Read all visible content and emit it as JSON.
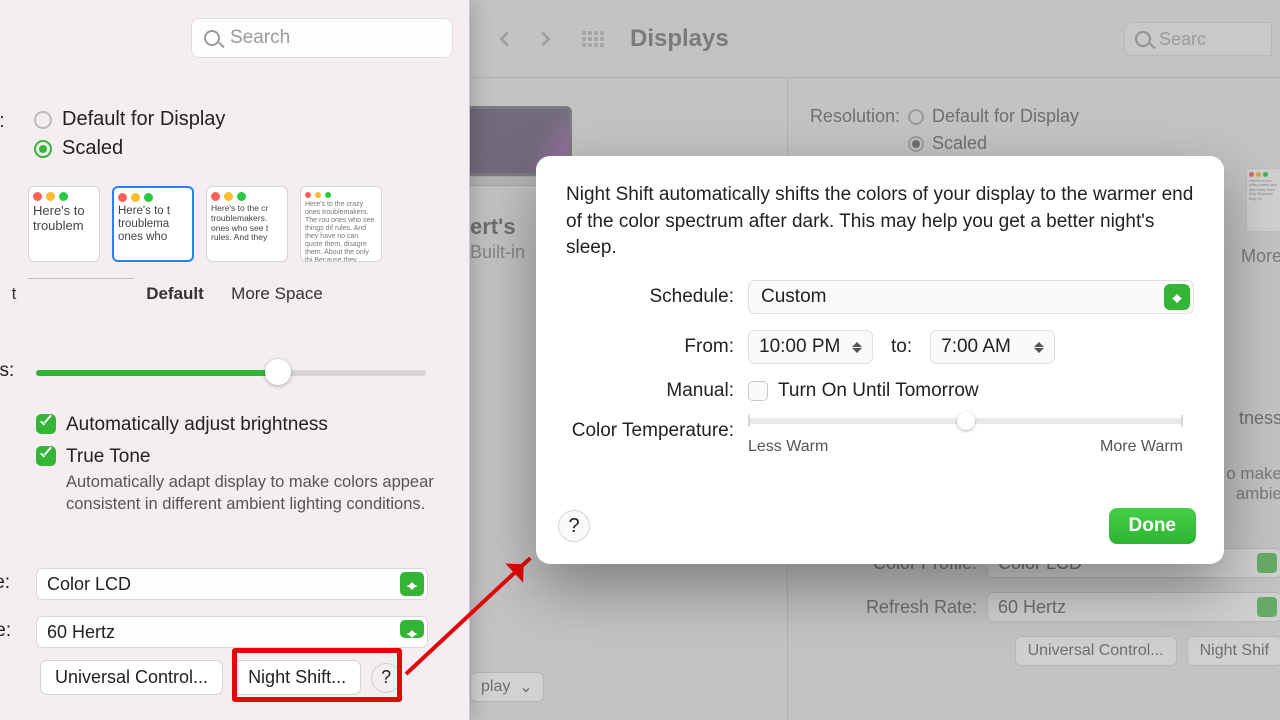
{
  "bg": {
    "title": "Displays",
    "search_placeholder": "Searc",
    "resolution_label": "Resolution:",
    "opt_default": "Default for Display",
    "opt_scaled": "Scaled",
    "more_space": "More",
    "left": {
      "name": "ert's",
      "sub": "Built-in"
    },
    "brightness_label": "tness",
    "truetone_tail1": "o make",
    "truetone_tail2": "ambie",
    "color_profile_label": "Color Profile:",
    "color_profile_value": "Color LCD",
    "refresh_label": "Refresh Rate:",
    "refresh_value": "60 Hertz",
    "display_btn": "play",
    "uc_btn": "Universal Control...",
    "ns_btn": "Night Shif"
  },
  "fg": {
    "search_placeholder": "Search",
    "resolution_suffix": "n:",
    "opt_default": "Default for Display",
    "opt_scaled": "Scaled",
    "thumb_text_large": "Here's to troublem",
    "thumb_text_med": "Here's to t troublema ones who",
    "thumb_text_small": "Here's to the cr troublemakers. ones who see t rules. And they",
    "thumb_text_xsmall": "Here's to the crazy ones troublemakers. The rou ones who see things dif rules. And they have no can quote them, disagre them. About the only thi Because they change th",
    "cap_larger": "t",
    "cap_default": "Default",
    "cap_more": "More Space",
    "brightness_suffix": "ss:",
    "auto_brightness": "Automatically adjust brightness",
    "true_tone": "True Tone",
    "true_tone_desc": "Automatically adapt display to make colors appear consistent in different ambient lighting conditions.",
    "color_suffix": "le:",
    "color_value": "Color LCD",
    "rate_suffix": "te:",
    "rate_value": "60 Hertz",
    "uc_btn": "Universal Control...",
    "ns_btn": "Night Shift...",
    "help": "?"
  },
  "modal": {
    "desc": "Night Shift automatically shifts the colors of your display to the warmer end of the color spectrum after dark. This may help you get a better night's sleep.",
    "schedule_label": "Schedule:",
    "schedule_value": "Custom",
    "from_label": "From:",
    "from_value": "10:00 PM",
    "to_label": "to:",
    "to_value": "7:00 AM",
    "manual_label": "Manual:",
    "manual_checkbox": "Turn On Until Tomorrow",
    "temp_label": "Color Temperature:",
    "temp_less": "Less Warm",
    "temp_more": "More Warm",
    "help": "?",
    "done": "Done"
  }
}
